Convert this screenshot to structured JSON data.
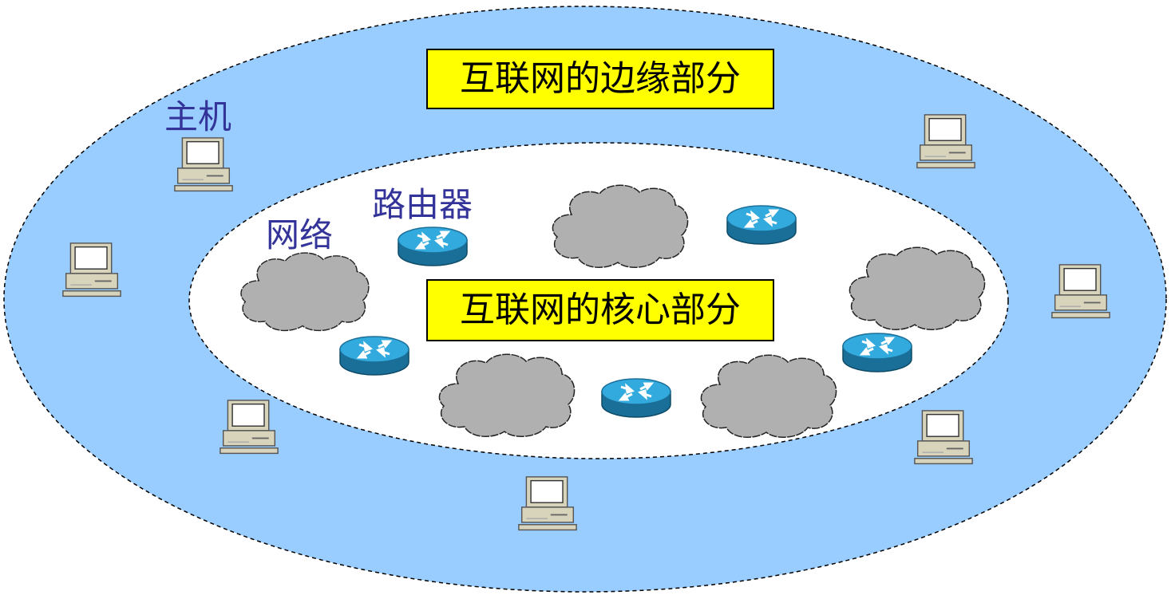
{
  "labels": {
    "edge": "互联网的边缘部分",
    "core": "互联网的核心部分",
    "host": "主机",
    "router": "路由器",
    "network": "网络"
  },
  "colors": {
    "edge_fill": "#99ccff",
    "core_fill": "#ffffff",
    "label_box": "#ffff00",
    "caption_text": "#333399",
    "cloud": "#b0b0b0",
    "router_top": "#33aadd",
    "router_side": "#1a6f99",
    "computer": "#d4d0b8"
  },
  "icons": {
    "host": "desktop-computer-icon",
    "router": "router-icon",
    "network": "cloud-icon"
  }
}
